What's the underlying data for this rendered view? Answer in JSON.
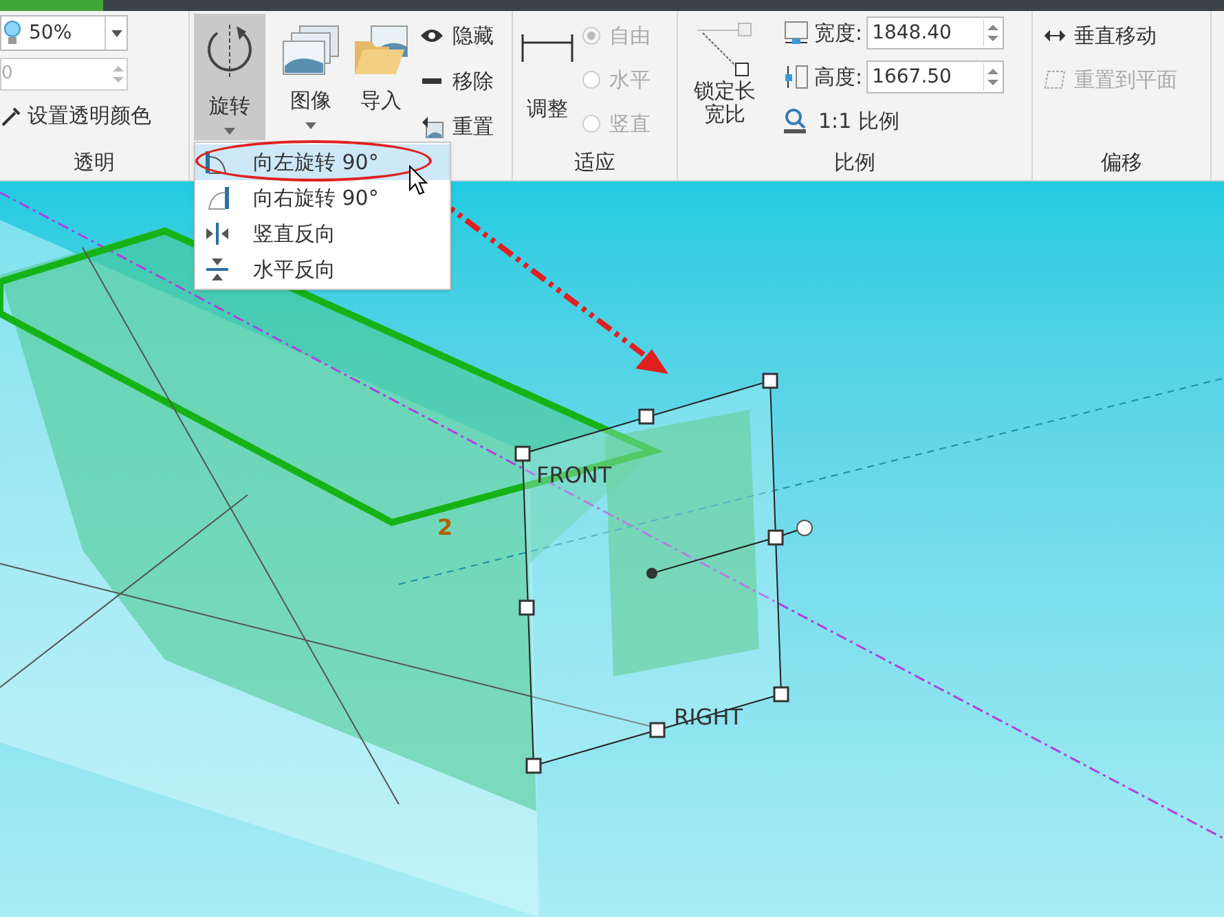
{
  "ribbon": {
    "transparency": {
      "opacity": "50%",
      "spin_value": "0",
      "pick_color": "设置透明颜色",
      "label": "透明"
    },
    "rotate": {
      "label": "旋转",
      "expanded": true
    },
    "image": {
      "image_button": "图像",
      "import_button": "导入",
      "actions": [
        {
          "kind": "hide",
          "label": "隐藏"
        },
        {
          "kind": "remove",
          "label": "移除"
        },
        {
          "kind": "reset",
          "label": "重置"
        }
      ]
    },
    "fit": {
      "adjust": "调整",
      "options": [
        {
          "label": "自由",
          "selected": true,
          "disabled": true
        },
        {
          "label": "水平",
          "selected": false,
          "disabled": true
        },
        {
          "label": "竖直",
          "selected": false,
          "disabled": true
        }
      ],
      "label": "适应"
    },
    "scale": {
      "lock_aspect": "锁定长宽比",
      "width_label": "宽度:",
      "width_value": "1848.40",
      "height_label": "高度:",
      "height_value": "1667.50",
      "one_to_one": "1:1 比例",
      "label": "比例"
    },
    "offset": {
      "actions": [
        {
          "label": "垂直移动",
          "disabled": false
        },
        {
          "label": "重置到平面",
          "disabled": true
        }
      ],
      "label": "偏移"
    }
  },
  "rotate_menu": {
    "items": [
      {
        "kind": "rotate_left",
        "label": "向左旋转 90°",
        "selected": true
      },
      {
        "kind": "rotate_right",
        "label": "向右旋转 90°",
        "selected": false
      },
      {
        "kind": "flip_vertical",
        "label": "竖直反向",
        "selected": false
      },
      {
        "kind": "flip_horizontal",
        "label": "水平反向",
        "selected": false
      }
    ]
  },
  "viewport": {
    "labels": [
      {
        "kind": "plane",
        "text": "FRONT"
      },
      {
        "kind": "plane",
        "text": "RIGHT"
      },
      {
        "kind": "sketch",
        "text": "2"
      }
    ]
  }
}
